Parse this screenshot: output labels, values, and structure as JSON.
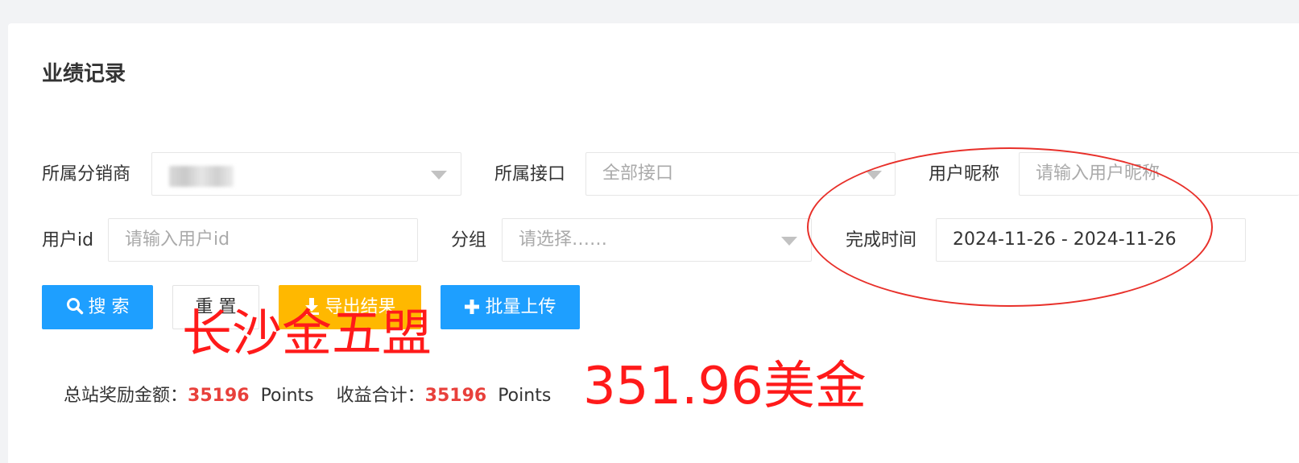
{
  "page": {
    "title": "业绩记录"
  },
  "filters": {
    "distributor": {
      "label": "所属分销商",
      "value": ""
    },
    "interface": {
      "label": "所属接口",
      "value": "全部接口"
    },
    "nickname": {
      "label": "用户昵称",
      "placeholder": "请输入用户昵称"
    },
    "user_id": {
      "label": "用户id",
      "placeholder": "请输入用户id"
    },
    "group": {
      "label": "分组",
      "placeholder": "请选择……"
    },
    "finish_time": {
      "label": "完成时间",
      "value": "2024-11-26 - 2024-11-26"
    }
  },
  "buttons": {
    "search": "搜 索",
    "reset": "重 置",
    "export": "导出结果",
    "batch_upload": "批量上传"
  },
  "stats": {
    "total_reward_label": "总站奖励金额：",
    "total_reward_value": "35196",
    "total_reward_unit": "Points",
    "income_label": "收益合计：",
    "income_value": "35196",
    "income_unit": "Points"
  },
  "annotations": {
    "text_1": "长沙金五盟",
    "text_2": "351.96美金",
    "color": "#ff1a1a"
  },
  "colors": {
    "primary": "#1e9fff",
    "warning": "#ffb800",
    "highlight": "#e8403b"
  }
}
